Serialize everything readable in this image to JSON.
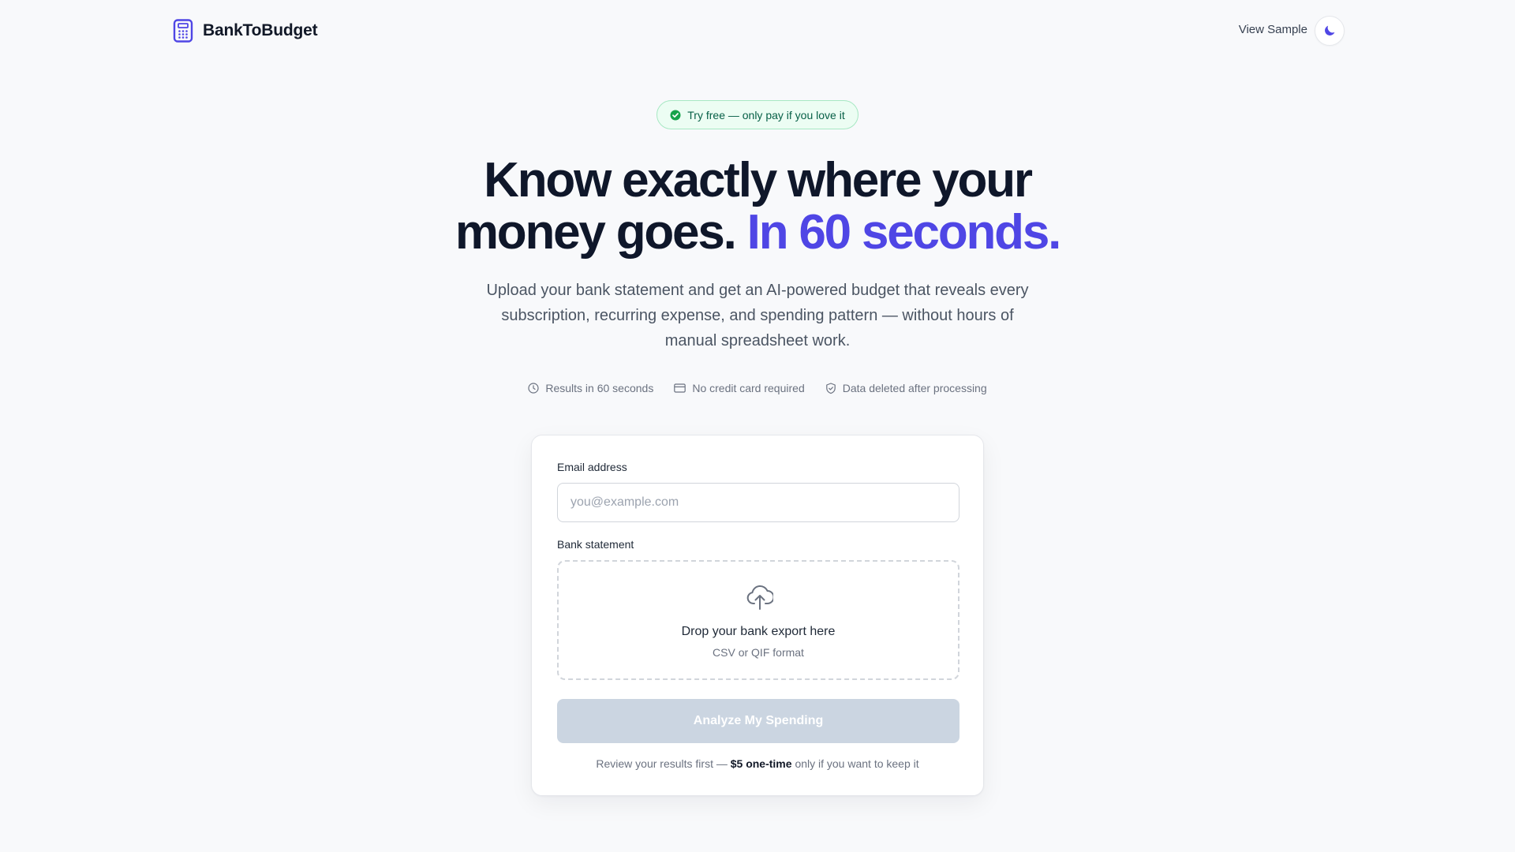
{
  "header": {
    "brand_name": "BankToBudget",
    "brand_icon": "calculator-icon",
    "view_sample_label": "View Sample",
    "theme_toggle_icon": "moon-icon"
  },
  "hero": {
    "badge_icon": "check-circle-icon",
    "badge_text": "Try free — only pay if you love it",
    "headline_line1": "Know exactly where your",
    "headline_line2_start": "money goes.",
    "headline_accent": "In 60 seconds.",
    "subheadline": "Upload your bank statement and get an AI-powered budget that reveals every subscription, recurring expense, and spending pattern — without hours of manual spreadsheet work.",
    "features": [
      {
        "icon": "clock-icon",
        "label": "Results in 60 seconds"
      },
      {
        "icon": "credit-card-icon",
        "label": "No credit card required"
      },
      {
        "icon": "shield-icon",
        "label": "Data deleted after processing"
      }
    ]
  },
  "form": {
    "email_label": "Email address",
    "email_value": "",
    "email_placeholder": "you@example.com",
    "statement_label": "Bank statement",
    "dropzone_icon": "upload-cloud-icon",
    "dropzone_title": "Drop your bank export here",
    "dropzone_subtitle": "CSV or QIF format",
    "submit_label": "Analyze My Spending",
    "footnote_prefix": "Review your results first —",
    "footnote_price": "$5 one-time",
    "footnote_suffix": "only if you want to keep it"
  },
  "colors": {
    "accent": "#4f46e5",
    "background": "#f8f9fb",
    "badge_bg": "#ecfdf3",
    "badge_text": "#065f46",
    "button_disabled": "#cbd5e1"
  }
}
